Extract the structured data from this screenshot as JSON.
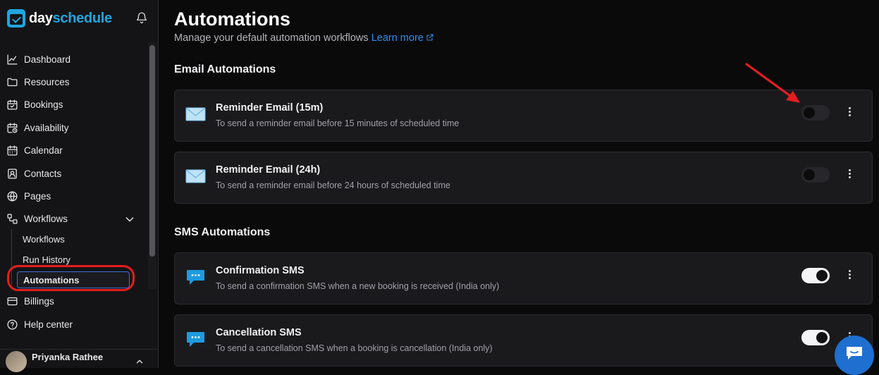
{
  "brand": {
    "name_part1": "day",
    "name_part2": "schedule"
  },
  "sidebar": {
    "items": [
      {
        "label": "Dashboard",
        "icon": "chart-line-icon"
      },
      {
        "label": "Resources",
        "icon": "folder-icon"
      },
      {
        "label": "Bookings",
        "icon": "calendar-check-icon"
      },
      {
        "label": "Availability",
        "icon": "calendar-clock-icon"
      },
      {
        "label": "Calendar",
        "icon": "calendar-icon"
      },
      {
        "label": "Contacts",
        "icon": "contact-icon"
      },
      {
        "label": "Pages",
        "icon": "globe-icon"
      },
      {
        "label": "Workflows",
        "icon": "workflow-icon"
      }
    ],
    "subitems": [
      {
        "label": "Workflows"
      },
      {
        "label": "Run History"
      },
      {
        "label": "Automations",
        "active": true
      }
    ],
    "bottom_items": [
      {
        "label": "Billings",
        "icon": "card-icon"
      },
      {
        "label": "Help center",
        "icon": "help-icon"
      }
    ],
    "user": {
      "name": "Priyanka Rathee"
    }
  },
  "main": {
    "title": "Automations",
    "subtitle": "Manage your default automation workflows",
    "learn_more": "Learn more",
    "sections": [
      {
        "title": "Email Automations",
        "cards": [
          {
            "title": "Reminder Email (15m)",
            "desc": "To send a reminder email before 15 minutes of scheduled time",
            "enabled": false,
            "icon": "mail-icon"
          },
          {
            "title": "Reminder Email (24h)",
            "desc": "To send a reminder email before 24 hours of scheduled time",
            "enabled": false,
            "icon": "mail-icon"
          }
        ]
      },
      {
        "title": "SMS Automations",
        "cards": [
          {
            "title": "Confirmation SMS",
            "desc": "To send a confirmation SMS when a new booking is received (India only)",
            "enabled": true,
            "icon": "sms-icon"
          },
          {
            "title": "Cancellation SMS",
            "desc": "To send a cancellation SMS when a booking is cancellation (India only)",
            "enabled": true,
            "icon": "sms-icon"
          }
        ]
      }
    ]
  },
  "colors": {
    "accent": "#1fa6e0",
    "link": "#2e8ff0",
    "annotation": "#e51d1d",
    "chat": "#1e6fd0"
  }
}
